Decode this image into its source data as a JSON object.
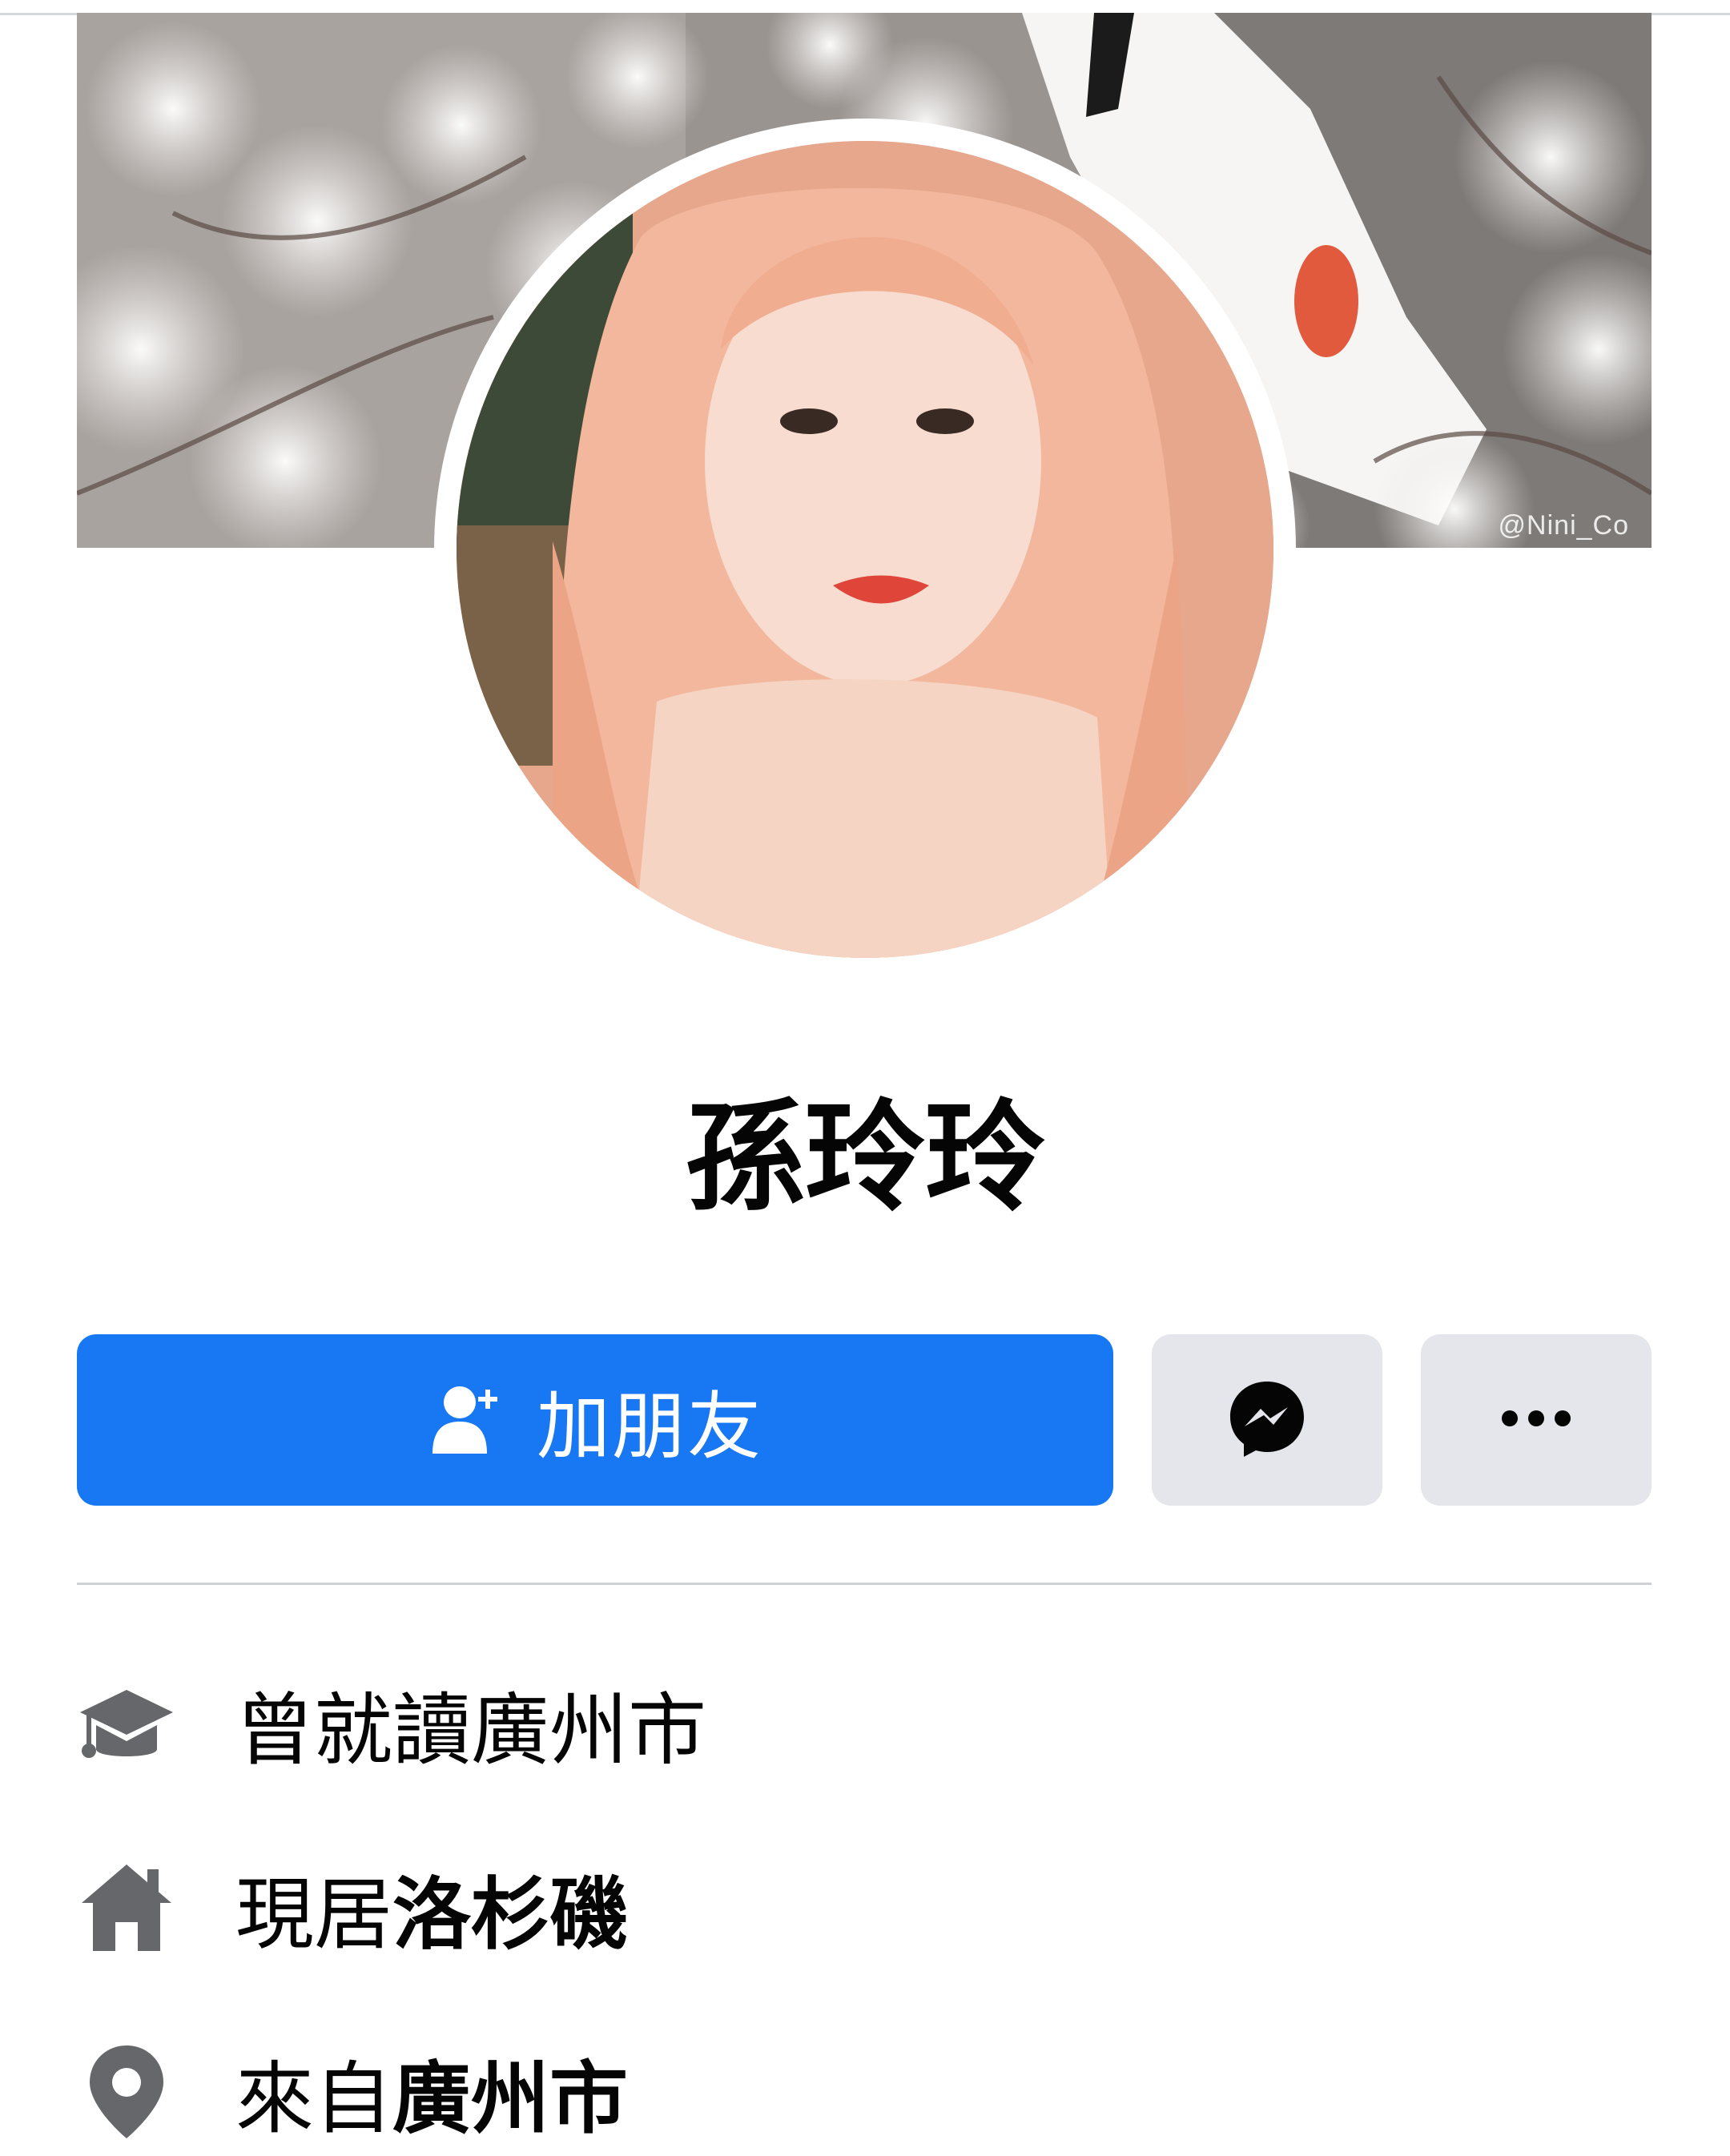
{
  "cover": {
    "watermark": "@Nini_Co"
  },
  "profile": {
    "name": "孫玲玲"
  },
  "actions": {
    "add_friend_label": "加朋友",
    "add_friend_icon": "add-friend-icon",
    "messenger_icon": "messenger-icon",
    "more_icon": "more-options-icon"
  },
  "intro": {
    "items": [
      {
        "icon": "graduation-cap-icon",
        "prefix": "曾就讀廣州市",
        "value": ""
      },
      {
        "icon": "home-icon",
        "prefix": "現居",
        "value": "洛杉磯"
      },
      {
        "icon": "location-pin-icon",
        "prefix": "來自",
        "value": "廣州市"
      }
    ]
  },
  "colors": {
    "primary": "#1877f2",
    "secondary_button": "#e4e6eb",
    "icon_grey": "#65676b",
    "text": "#050505"
  }
}
